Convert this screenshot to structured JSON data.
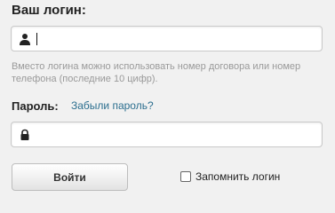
{
  "login": {
    "label": "Ваш логин:",
    "value": "",
    "icon": "user-icon"
  },
  "hint": "Вместо логина можно использовать номер договора или номер телефона (последние 10 цифр).",
  "password": {
    "label": "Пароль:",
    "forgot_link": "Забыли пароль?",
    "value": "",
    "icon": "lock-icon"
  },
  "submit_label": "Войти",
  "remember_label": "Запомнить логин",
  "remember_checked": false,
  "colors": {
    "background": "#f1f1f1",
    "link": "#2c6f8f",
    "hint": "#9a9a9a"
  }
}
